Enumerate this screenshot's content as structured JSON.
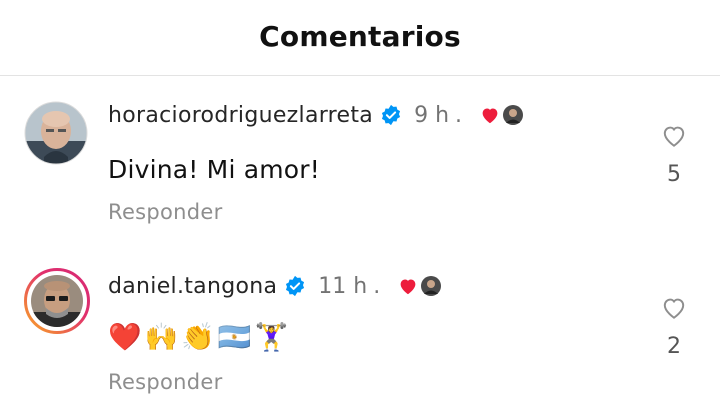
{
  "header": {
    "title": "Comentarios"
  },
  "comments": [
    {
      "username": "horaciorodriguezlarreta",
      "time": "9 h",
      "dot": ".",
      "text": "Divina! Mi amor!",
      "reply_label": "Responder",
      "likes": "5",
      "avatar_icon": "bald-man-avatar",
      "has_story_ring": false
    },
    {
      "username": "daniel.tangona",
      "time": "11 h",
      "dot": ".",
      "text": "❤️🙌👏🇦🇷🏋️‍♀️",
      "emojis": [
        "❤️",
        "🙌",
        "👏",
        "🇦🇷",
        "🏋️‍♀️"
      ],
      "reply_label": "Responder",
      "likes": "2",
      "avatar_icon": "man-with-glasses-avatar",
      "has_story_ring": true
    }
  ],
  "colors": {
    "verified": "#0095f6",
    "liked_by_author_heart": "#ed1d3c",
    "story_ring_start": "#f9a825",
    "story_ring_end": "#d62976"
  }
}
